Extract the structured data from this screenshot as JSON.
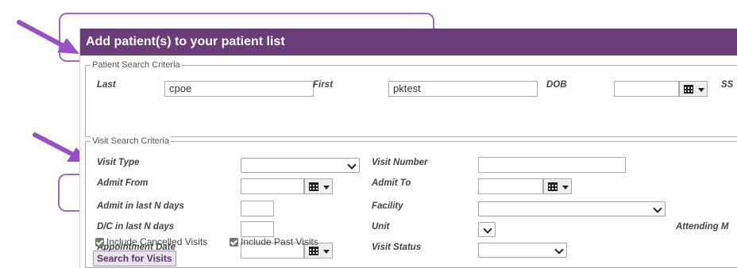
{
  "dialog": {
    "title": "Add patient(s) to your patient list"
  },
  "patient_search": {
    "legend": "Patient Search Criteria",
    "last_label": "Last",
    "last_value": "cpoe",
    "first_label": "First",
    "first_value": "pktest",
    "dob_label": "DOB",
    "dob_value": "",
    "ssn_label": "SS"
  },
  "visit_search": {
    "legend": "Visit Search Criteria",
    "visit_type_label": "Visit Type",
    "visit_type_value": "",
    "visit_number_label": "Visit Number",
    "visit_number_value": "",
    "admit_from_label": "Admit From",
    "admit_from_value": "",
    "admit_to_label": "Admit To",
    "admit_to_value": "",
    "admit_n_days_label": "Admit in last N days",
    "admit_n_days_value": "",
    "facility_label": "Facility",
    "facility_value": "",
    "dc_n_days_label": "D/C in last N days",
    "dc_n_days_value": "",
    "unit_label": "Unit",
    "unit_value": "",
    "attending_label": "Attending M",
    "appointment_date_label": "Appointment Date",
    "appointment_date_value": "",
    "visit_status_label": "Visit Status",
    "visit_status_value": "",
    "include_cancelled_label": "Include Cancelled Visits",
    "include_cancelled_checked": true,
    "include_past_label": "Include Past Visits",
    "include_past_checked": true,
    "search_button_label": "Search for Visits"
  },
  "colors": {
    "title_bar": "#6b3d78",
    "callout": "#9b6bc4",
    "arrow": "#9b4fc4"
  },
  "icons": [
    "arrow-pointer-icon",
    "calendar-icon",
    "chevron-down-icon",
    "checkbox-checked-icon"
  ]
}
